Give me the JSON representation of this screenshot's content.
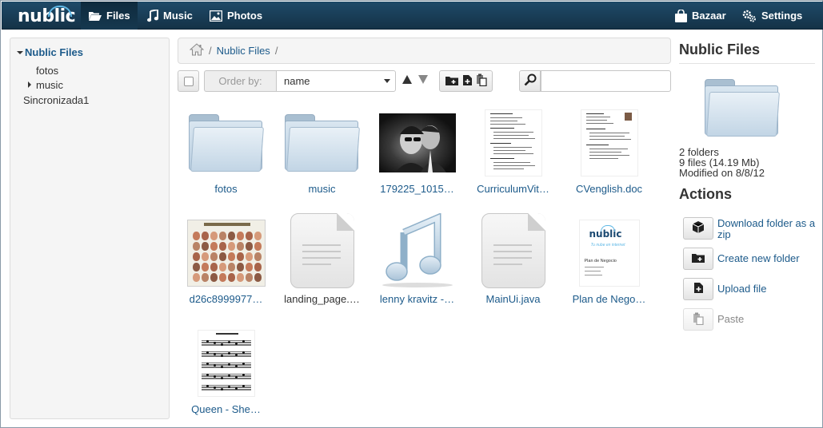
{
  "topbar": {
    "logo": "nublic",
    "nav": [
      {
        "label": "Files",
        "icon": "folder-open-icon"
      },
      {
        "label": "Music",
        "icon": "music-note-icon"
      },
      {
        "label": "Photos",
        "icon": "picture-icon"
      }
    ],
    "right": [
      {
        "label": "Bazaar",
        "icon": "shopping-bag-icon"
      },
      {
        "label": "Settings",
        "icon": "cogs-icon"
      }
    ]
  },
  "sidebar": {
    "root": "Nublic Files",
    "items": [
      {
        "label": "fotos"
      },
      {
        "label": "music"
      },
      {
        "label": "Sincronizada1"
      }
    ]
  },
  "breadcrumb": {
    "home_icon": "home-icon",
    "separator": "/",
    "items": [
      "Nublic Files"
    ]
  },
  "toolbar": {
    "order_by_label": "Order by:",
    "order_by_value": "name",
    "search_value": ""
  },
  "files": [
    {
      "name": "fotos",
      "kind": "folder"
    },
    {
      "name": "music",
      "kind": "folder"
    },
    {
      "name": "179225_1015…",
      "kind": "photo"
    },
    {
      "name": "CurriculumVit…",
      "kind": "document-thumb"
    },
    {
      "name": "CVenglish.doc",
      "kind": "document-thumb"
    },
    {
      "name": "d26c8999977…",
      "kind": "image"
    },
    {
      "name": "landing_page.…",
      "kind": "text-file"
    },
    {
      "name": "lenny kravitz -…",
      "kind": "audio"
    },
    {
      "name": "MainUi.java",
      "kind": "text-file"
    },
    {
      "name": "Plan de Nego…",
      "kind": "document-thumb"
    },
    {
      "name": "Queen - She…",
      "kind": "sheet-music"
    }
  ],
  "plan_thumb": {
    "logo": "nublic",
    "tagline": "Tu nube en internet",
    "heading": "Plan de Negocio"
  },
  "panel": {
    "title": "Nublic Files",
    "folders": "2 folders",
    "files": "9 files (14.19 Mb)",
    "modified": "Modified on 8/8/12",
    "actions_title": "Actions",
    "actions": [
      {
        "label": "Download folder as a zip",
        "icon": "box-icon",
        "enabled": true
      },
      {
        "label": "Create new folder",
        "icon": "new-folder-icon",
        "enabled": true
      },
      {
        "label": "Upload file",
        "icon": "upload-file-icon",
        "enabled": true
      },
      {
        "label": "Paste",
        "icon": "paste-icon",
        "enabled": false
      }
    ]
  },
  "colors": {
    "topbar": "#1a3f59",
    "link": "#1c5a8a",
    "logo_cloud": "#5fb8e6"
  }
}
